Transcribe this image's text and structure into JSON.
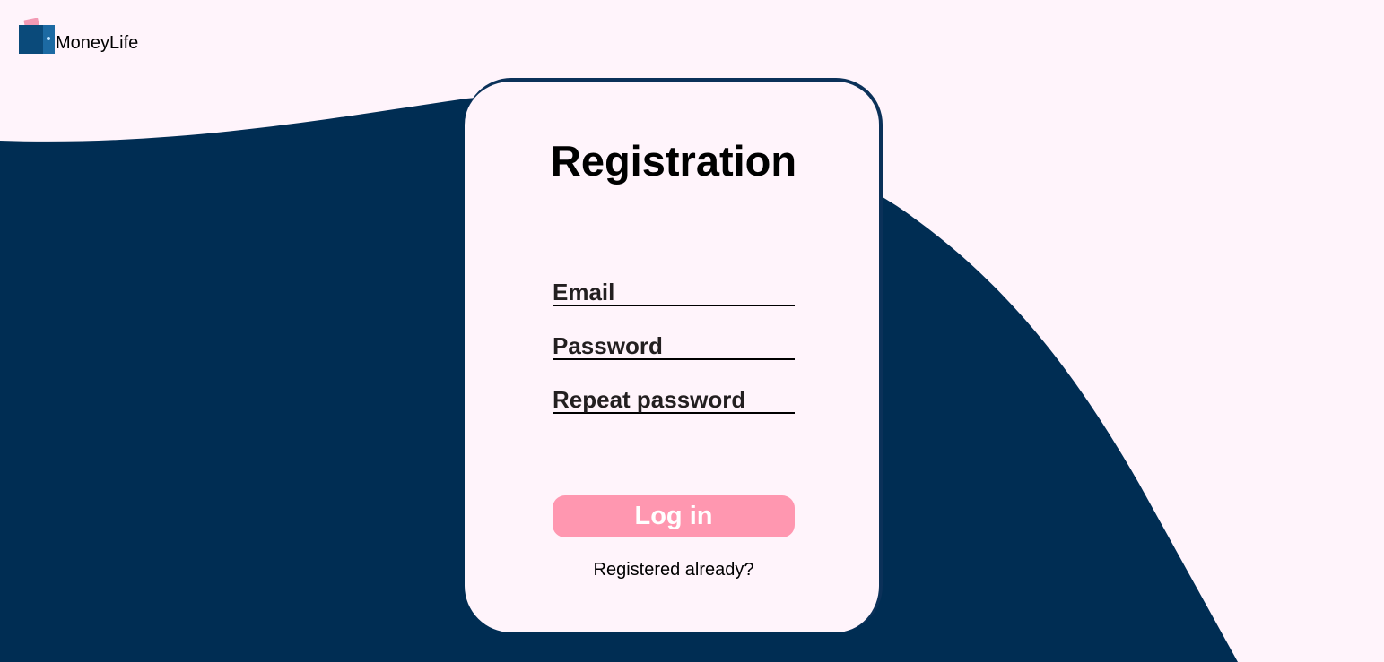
{
  "brand": {
    "name": "MoneyLife",
    "logo_icon": "wallet-icon"
  },
  "colors": {
    "background": "#fff4fb",
    "wave": "#002d53",
    "card_border": "#0b3159",
    "button": "#ff97b0",
    "button_text": "#ffffff",
    "logo_blue": "#0a4a7a",
    "logo_pink": "#f39ab4"
  },
  "form": {
    "title": "Registration",
    "fields": [
      {
        "label": "Email"
      },
      {
        "label": "Password"
      },
      {
        "label": "Repeat password"
      }
    ],
    "submit_label": "Log in",
    "alt_link": "Registered already?"
  }
}
